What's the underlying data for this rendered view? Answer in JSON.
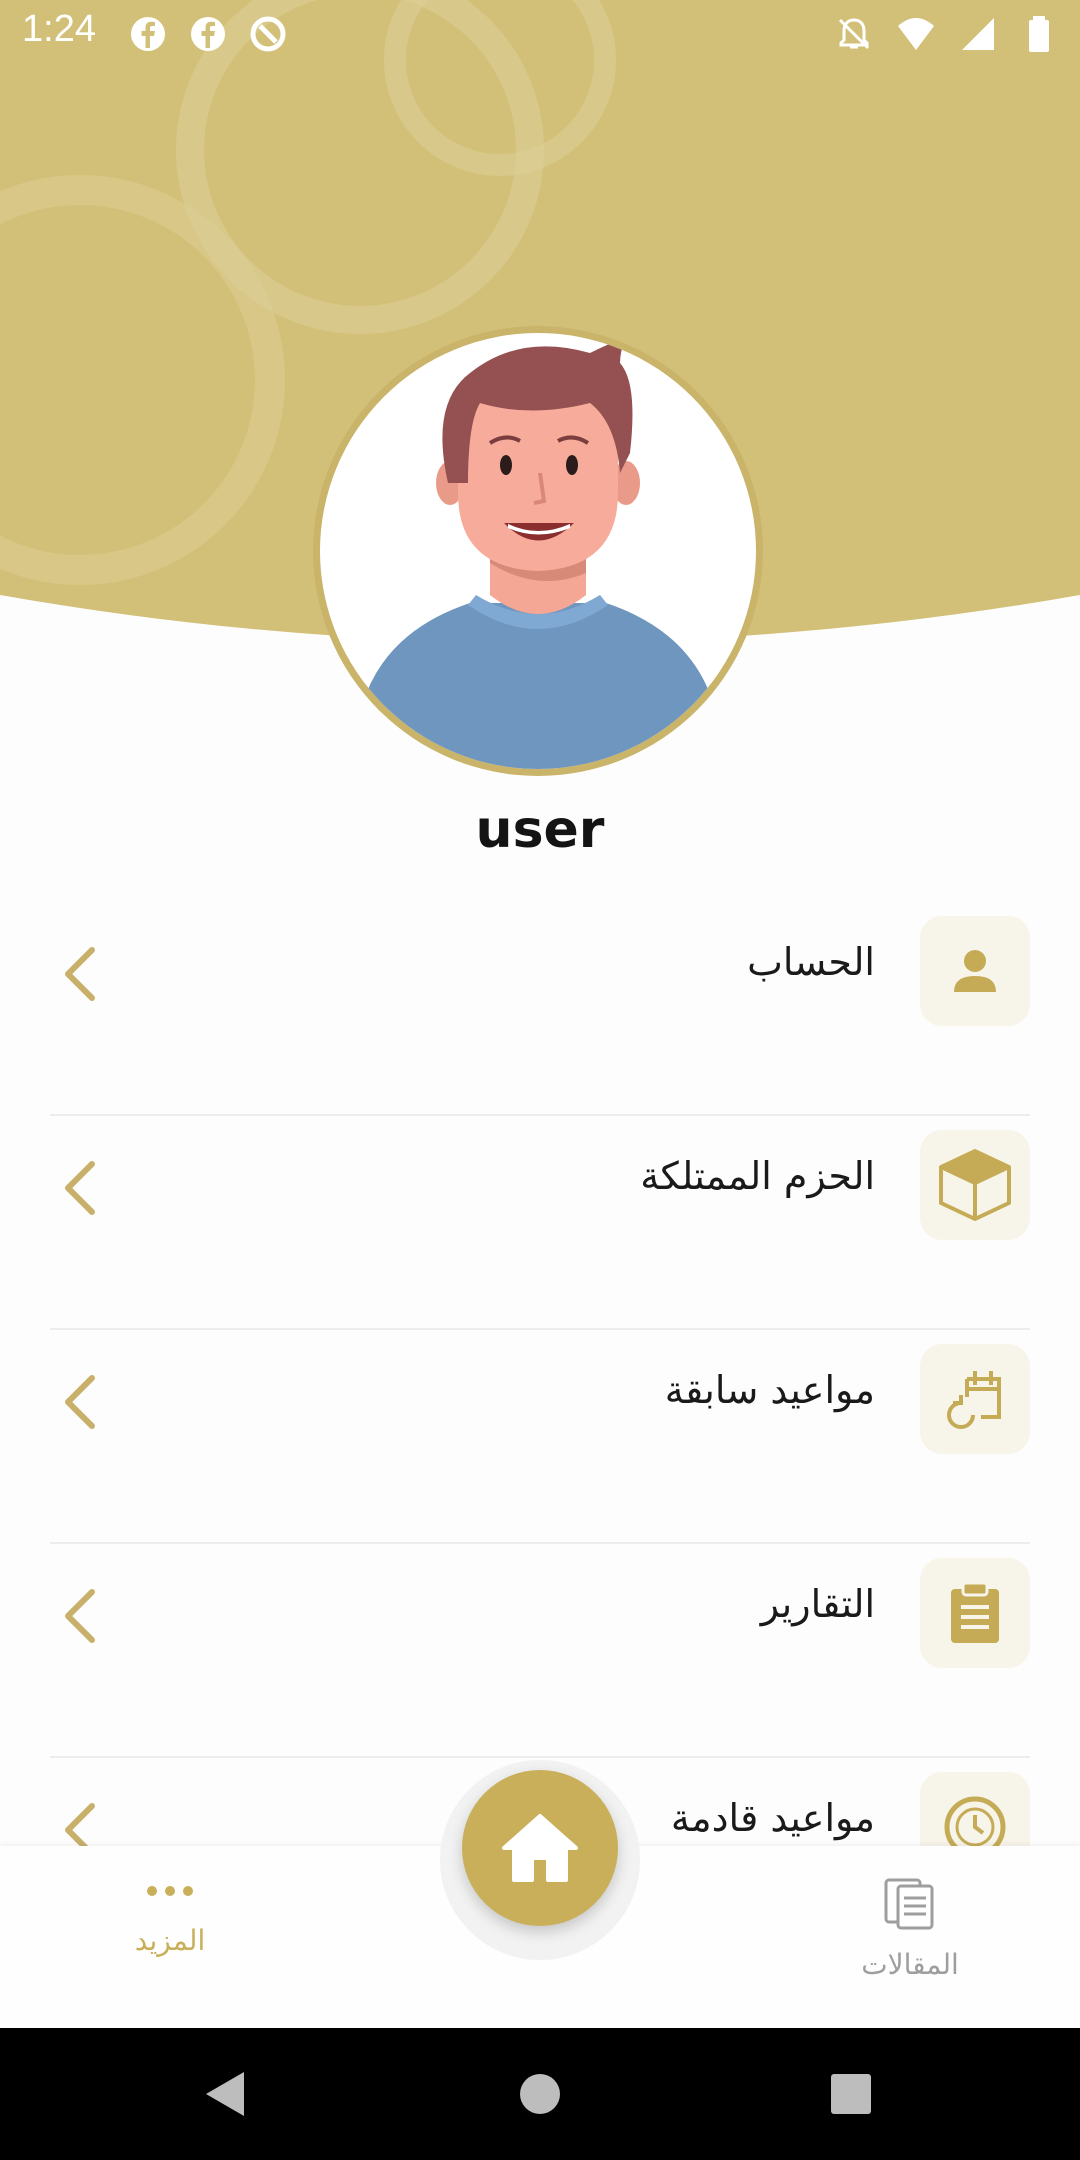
{
  "status_bar": {
    "time": "1:24",
    "left_icons": [
      "facebook-icon",
      "facebook-icon",
      "data-saver-icon"
    ],
    "right_icons": [
      "notifications-off-icon",
      "wifi-icon",
      "signal-icon",
      "battery-icon"
    ]
  },
  "profile": {
    "name": "user"
  },
  "menu": {
    "items": [
      {
        "label": "الحساب",
        "icon": "person-icon"
      },
      {
        "label": "الحزم الممتلكة",
        "icon": "box-icon"
      },
      {
        "label": "مواعيد سابقة",
        "icon": "calendar-history-icon"
      },
      {
        "label": "التقارير",
        "icon": "clipboard-icon"
      },
      {
        "label": "مواعيد قادمة",
        "icon": "clock-icon"
      }
    ]
  },
  "bottom_nav": {
    "more_label": "المزيد",
    "articles_label": "المقالات",
    "home_icon": "home-icon"
  },
  "colors": {
    "accent": "#C9AF5A",
    "header": "#D3C078",
    "icon_bg": "#F7F4EA",
    "inactive": "#9E9E9E"
  }
}
